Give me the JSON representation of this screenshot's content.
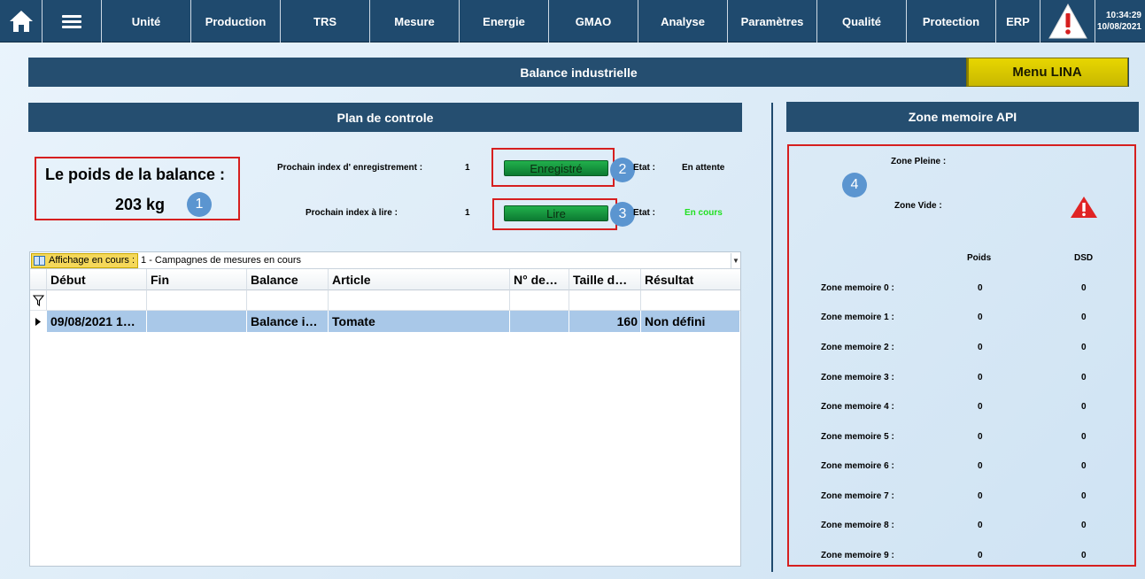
{
  "nav": {
    "items": [
      "Unité",
      "Production",
      "TRS",
      "Mesure",
      "Energie",
      "GMAO",
      "Analyse",
      "Paramètres",
      "Qualité",
      "Protection",
      "ERP"
    ],
    "time": "10:34:29",
    "date": "10/08/2021"
  },
  "header": {
    "title": "Balance industrielle",
    "menu_button": "Menu LINA"
  },
  "plan": {
    "title": "Plan de controle",
    "poids_label": "Le poids de la balance :",
    "poids_value": "203 kg",
    "next_write_label": "Prochain index d' enregistrement :",
    "next_write_value": "1",
    "write_button": "Enregistré",
    "write_state_label": "Etat :",
    "write_state": "En attente",
    "next_read_label": "Prochain index à lire :",
    "next_read_value": "1",
    "read_button": "Lire",
    "read_state_label": "Etat :",
    "read_state": "En cours"
  },
  "badges": [
    "1",
    "2",
    "3",
    "4"
  ],
  "grid": {
    "display_label": "Affichage en cours :",
    "display_value": "1 - Campagnes de mesures en cours",
    "columns": [
      "Début",
      "Fin",
      "Balance",
      "Article",
      "N° de…",
      "Taille d…",
      "Résultat"
    ],
    "rows": [
      [
        "09/08/2021 1…",
        "",
        "Balance i…",
        "Tomate",
        "",
        "160",
        "Non défini"
      ]
    ]
  },
  "zone": {
    "title": "Zone memoire API",
    "pleine_label": "Zone Pleine :",
    "vide_label": "Zone Vide :",
    "col_poids": "Poids",
    "col_dsd": "DSD",
    "rows": [
      {
        "label": "Zone memoire 0 :",
        "poids": "0",
        "dsd": "0"
      },
      {
        "label": "Zone memoire 1 :",
        "poids": "0",
        "dsd": "0"
      },
      {
        "label": "Zone memoire 2 :",
        "poids": "0",
        "dsd": "0"
      },
      {
        "label": "Zone memoire 3 :",
        "poids": "0",
        "dsd": "0"
      },
      {
        "label": "Zone memoire 4 :",
        "poids": "0",
        "dsd": "0"
      },
      {
        "label": "Zone memoire 5 :",
        "poids": "0",
        "dsd": "0"
      },
      {
        "label": "Zone memoire 6 :",
        "poids": "0",
        "dsd": "0"
      },
      {
        "label": "Zone memoire 7 :",
        "poids": "0",
        "dsd": "0"
      },
      {
        "label": "Zone memoire 8 :",
        "poids": "0",
        "dsd": "0"
      },
      {
        "label": "Zone memoire 9 :",
        "poids": "0",
        "dsd": "0"
      }
    ]
  },
  "colors": {
    "nav_bg": "#1f4a6e",
    "bar_bg": "#254e70",
    "accent_yellow": "#e8d600",
    "green_button": "#22b14c",
    "status_green": "#22e022",
    "highlight_red": "#d61f1f",
    "selected_row": "#a9c8e8"
  }
}
